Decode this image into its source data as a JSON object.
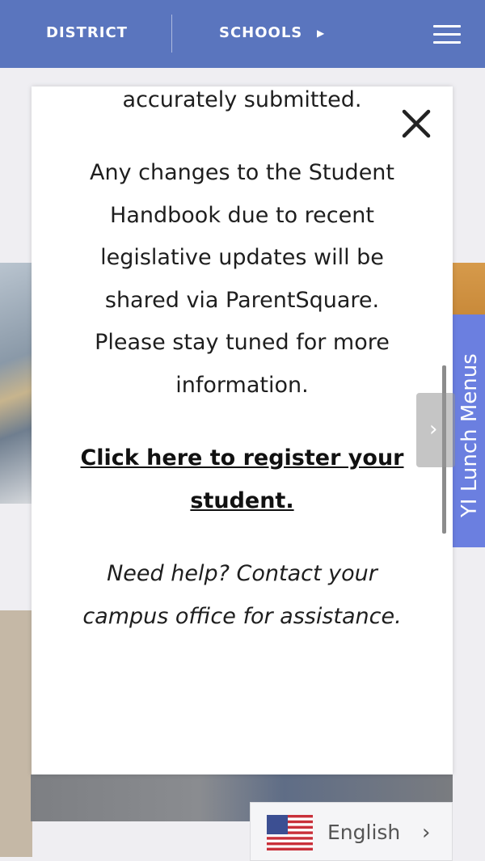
{
  "nav": {
    "district_label": "DISTRICT",
    "schools_label": "SCHOOLS",
    "menu_icon": "hamburger-menu-icon"
  },
  "side_tab": {
    "label": "Lunch Menus",
    "icon": "utensils-icon",
    "color": "#6b7fe0"
  },
  "modal": {
    "intro": "to ensure your information is accurately submitted.",
    "body": "Any changes to the Student Handbook due to recent legislative updates will be shared via ParentSquare. Please stay tuned for more information.",
    "register_link": "Click here to register your student.",
    "help": "Need help? Contact your campus office for assistance.",
    "close_icon": "close-icon"
  },
  "language": {
    "label": "English",
    "flag_icon": "us-flag-icon",
    "chevron_icon": "chevron-right-icon"
  },
  "colors": {
    "nav_bar": "#5a75be",
    "modal_bg": "#ffffff"
  }
}
